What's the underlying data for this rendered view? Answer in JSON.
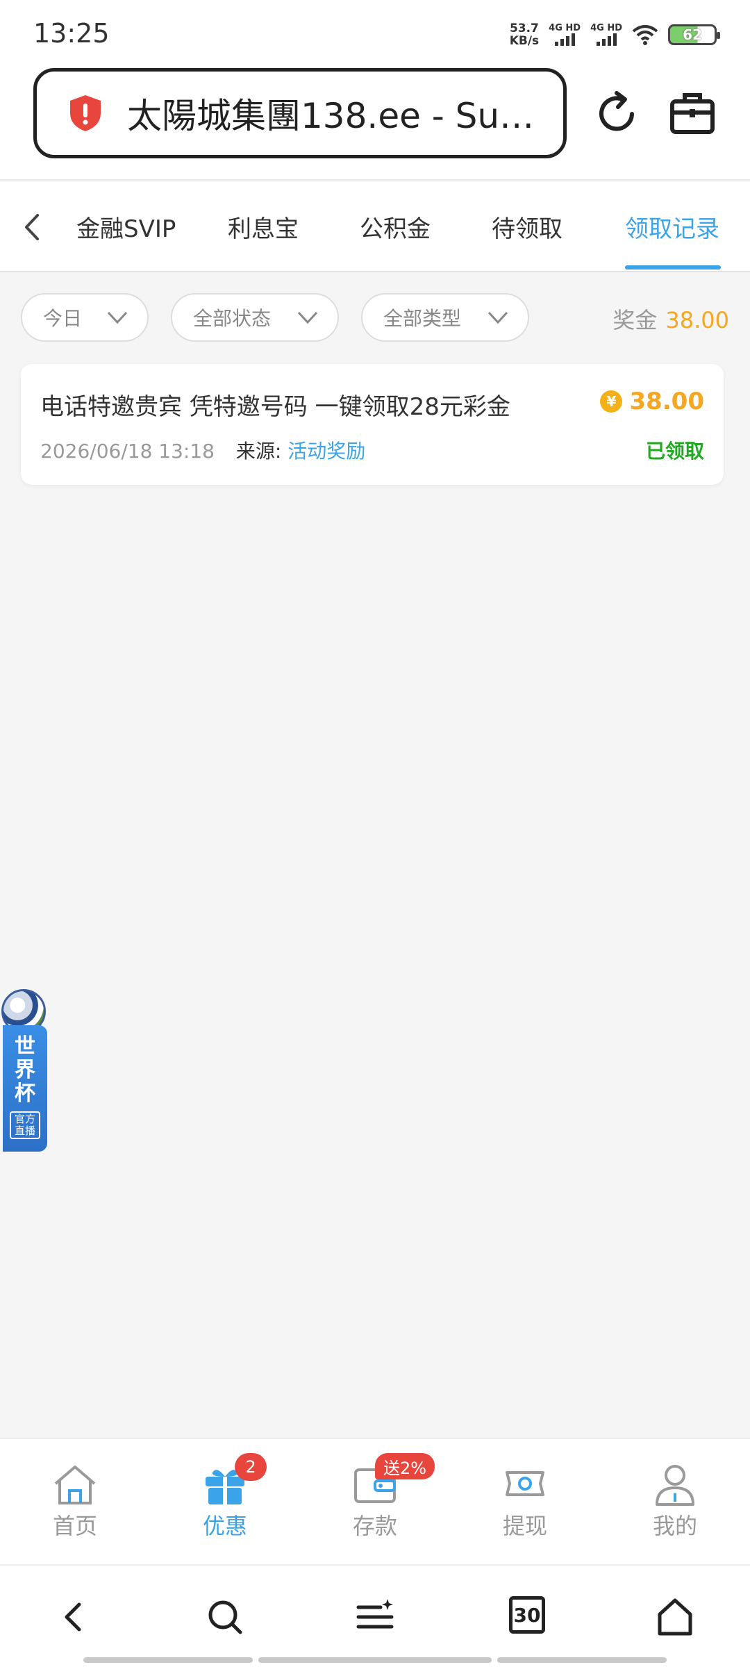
{
  "status_bar": {
    "time": "13:25",
    "net_speed_value": "53.7",
    "net_speed_unit": "KB/s",
    "sim1_label": "4G HD",
    "sim2_label": "4G HD",
    "battery": "62"
  },
  "browser": {
    "url_text": "太陽城集團138.ee - Su…",
    "icons": [
      "shield-alert-icon",
      "reload-icon",
      "toolbox-icon"
    ]
  },
  "tabs": {
    "items": [
      "金融SVIP",
      "利息宝",
      "公积金",
      "待领取",
      "领取记录"
    ],
    "active_index": 4
  },
  "filters": {
    "date": "今日",
    "status": "全部状态",
    "type": "全部类型",
    "bonus_label": "奖金",
    "bonus_total": "38.00"
  },
  "records": [
    {
      "title": "电话特邀贵宾 凭特邀号码 一键领取28元彩金",
      "amount": "38.00",
      "currency_symbol": "¥",
      "time": "2026/06/18 13:18",
      "source_label": "来源:",
      "source_value": "活动奖励",
      "status": "已领取"
    }
  ],
  "float_banner": {
    "text": "世界杯",
    "tag": "官方直播"
  },
  "app_nav": {
    "items": [
      {
        "label": "首页",
        "icon": "home-icon"
      },
      {
        "label": "优惠",
        "icon": "gift-icon",
        "badge": "2"
      },
      {
        "label": "存款",
        "icon": "wallet-icon",
        "badge": "送2%"
      },
      {
        "label": "提现",
        "icon": "cash-icon"
      },
      {
        "label": "我的",
        "icon": "user-icon"
      }
    ],
    "active_index": 1
  },
  "browser_toolbar": {
    "tab_count": "30",
    "icons": [
      "back-icon",
      "search-icon",
      "menu-icon",
      "tabs-icon",
      "home-icon"
    ]
  },
  "colors": {
    "accent": "#3ba4e8",
    "amount": "#f5a623",
    "success": "#22a922",
    "badge": "#e8453c"
  }
}
